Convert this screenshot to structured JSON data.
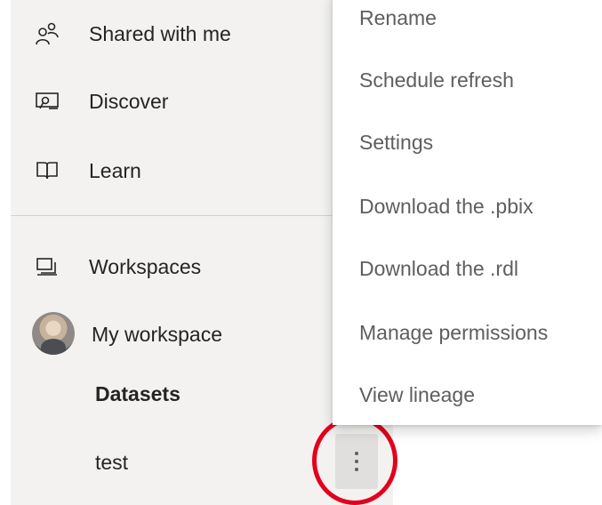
{
  "nav": {
    "items": [
      {
        "label": "Shared with me",
        "icon": "people-icon"
      },
      {
        "label": "Discover",
        "icon": "discover-icon"
      },
      {
        "label": "Learn",
        "icon": "book-icon"
      },
      {
        "label": "Workspaces",
        "icon": "workspaces-icon"
      },
      {
        "label": "My workspace",
        "icon": "avatar"
      }
    ],
    "sub_items": [
      {
        "label": "Datasets"
      },
      {
        "label": "test"
      }
    ]
  },
  "more_button": {
    "icon": "more-options-icon",
    "glyph": "⋮"
  },
  "highlight_color": "#e3001b",
  "context_menu": {
    "items": [
      {
        "label": "Rename"
      },
      {
        "label": "Schedule refresh"
      },
      {
        "label": "Settings"
      },
      {
        "label": "Download the .pbix"
      },
      {
        "label": "Download the .rdl"
      },
      {
        "label": "Manage permissions"
      },
      {
        "label": "View lineage"
      }
    ]
  }
}
